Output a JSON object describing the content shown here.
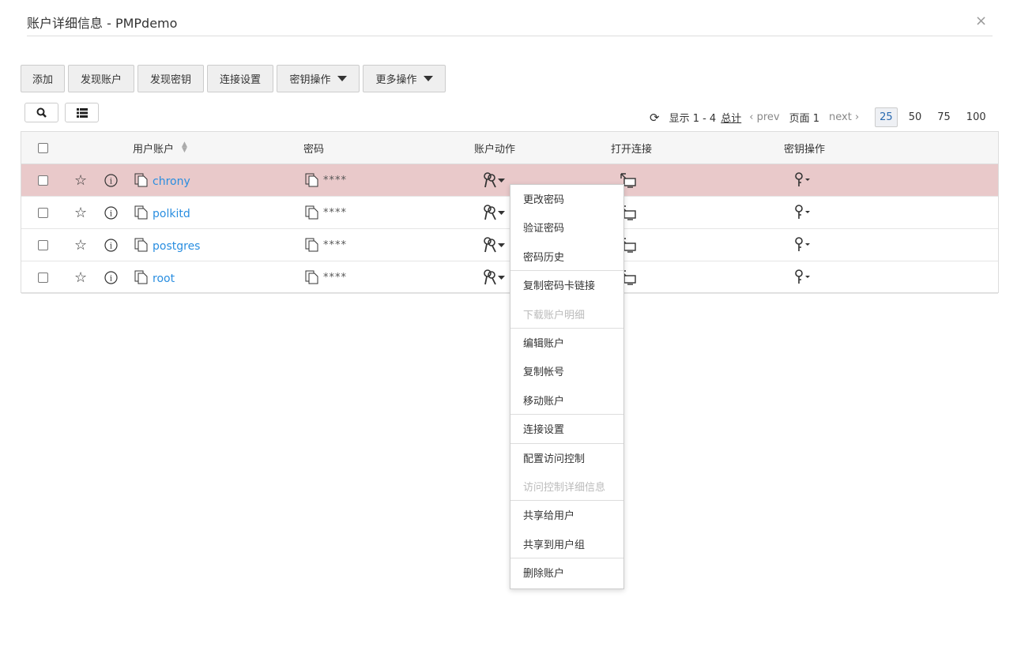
{
  "window": {
    "title": "账户详细信息 - PMPdemo",
    "close": "×"
  },
  "toolbar": {
    "add": "添加",
    "discover_accounts": "发现账户",
    "discover_keys": "发现密钥",
    "connection_settings": "连接设置",
    "key_ops": "密钥操作",
    "more_ops": "更多操作"
  },
  "pager": {
    "showing": "显示 1 - 4",
    "total": "总计",
    "prev": "prev",
    "page": "页面 1",
    "next": "next",
    "sizes": [
      "25",
      "50",
      "75",
      "100"
    ],
    "selected_size": "25"
  },
  "table": {
    "headers": {
      "account": "用户账户",
      "password": "密码",
      "account_actions": "账户动作",
      "open_connection": "打开连接",
      "key_ops": "密钥操作"
    },
    "rows": [
      {
        "name": "chrony",
        "password": "****"
      },
      {
        "name": "polkitd",
        "password": "****"
      },
      {
        "name": "postgres",
        "password": "****"
      },
      {
        "name": "root",
        "password": "****"
      }
    ]
  },
  "menu": {
    "items": [
      {
        "label": "更改密码",
        "disabled": false
      },
      {
        "label": "验证密码",
        "disabled": false
      },
      {
        "label": "密码历史",
        "disabled": false
      },
      {
        "label": "复制密码卡链接",
        "disabled": false
      },
      {
        "label": "下载账户明细",
        "disabled": true
      },
      {
        "label": "编辑账户",
        "disabled": false
      },
      {
        "label": "复制帐号",
        "disabled": false
      },
      {
        "label": "移动账户",
        "disabled": false
      },
      {
        "label": "连接设置",
        "disabled": false
      },
      {
        "label": "配置访问控制",
        "disabled": false
      },
      {
        "label": "访问控制详细信息",
        "disabled": true
      },
      {
        "label": "共享给用户",
        "disabled": false
      },
      {
        "label": "共享到用户组",
        "disabled": false
      },
      {
        "label": "删除账户",
        "disabled": false
      }
    ]
  },
  "colors": {
    "selected_row": "#e9c9ca",
    "link": "#2a8ee0"
  }
}
